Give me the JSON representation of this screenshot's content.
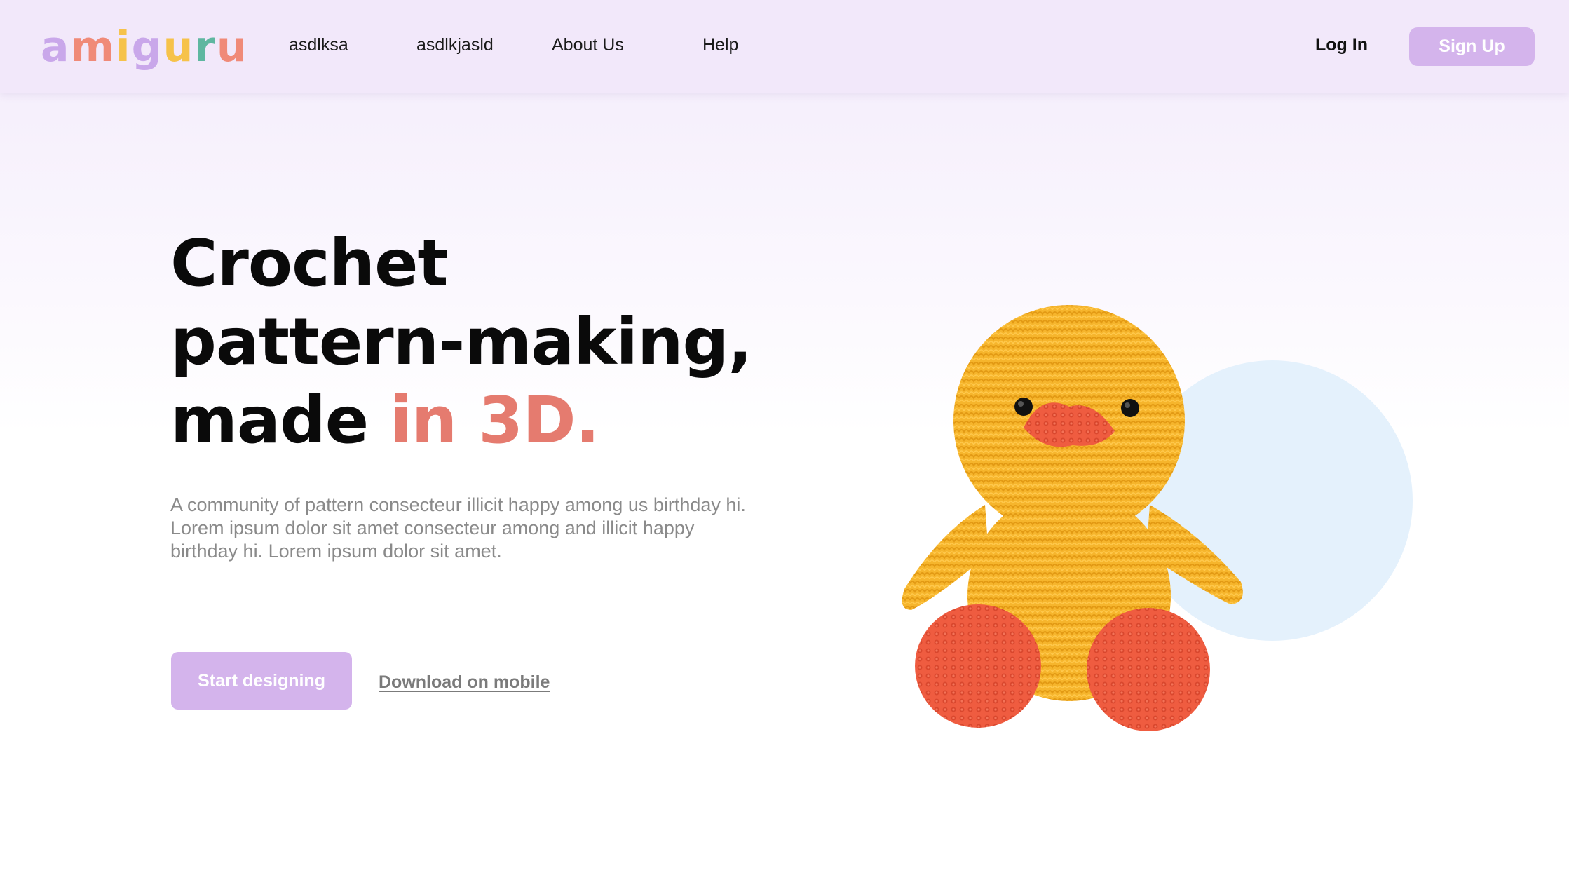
{
  "header": {
    "logo_letters": [
      {
        "char": "a",
        "color": "#c9a7ea"
      },
      {
        "char": "m",
        "color": "#f08a78"
      },
      {
        "char": "i",
        "color": "#f6c24a"
      },
      {
        "char": "g",
        "color": "#c9a7ea"
      },
      {
        "char": "u",
        "color": "#f6c24a"
      },
      {
        "char": "r",
        "color": "#5fb7a0"
      },
      {
        "char": "u",
        "color": "#f08a78"
      }
    ],
    "nav": [
      "asdlksa",
      "asdlkjasld",
      "About Us",
      "Help"
    ],
    "login_label": "Log In",
    "signup_label": "Sign Up"
  },
  "hero": {
    "headline_line1": "Crochet",
    "headline_line2": "pattern-making,",
    "headline_line3_plain": "made",
    "headline_line3_accent": "in 3D.",
    "description": "A community of pattern consecteur illicit happy among us birthday hi. Lorem ipsum dolor sit amet consecteur among and illicit happy birthday hi. Lorem ipsum dolor sit amet.",
    "cta_label": "Start designing",
    "download_label": "Download on mobile"
  },
  "colors": {
    "accent": "#e57b6f",
    "button": "#d4b4ec",
    "header_bg": "#f2e8fa",
    "circle": "#e4f1fc"
  },
  "illustration": {
    "subject": "crochet-duck-toy"
  }
}
